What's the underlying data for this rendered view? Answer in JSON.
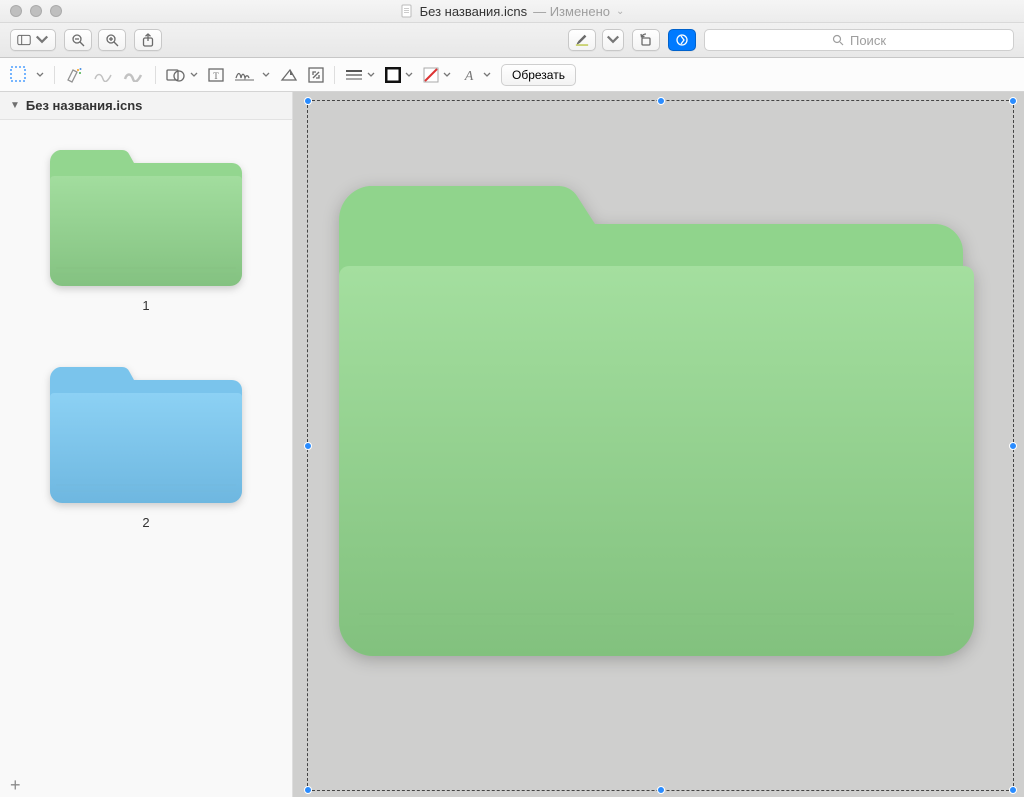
{
  "title": {
    "filename": "Без названия.icns",
    "separator": " — ",
    "status": "Изменено"
  },
  "toolbar": {
    "search_placeholder": "Поиск"
  },
  "markup": {
    "crop_label": "Обрезать"
  },
  "sidebar": {
    "header": "Без названия.icns",
    "thumbnails": [
      {
        "label": "1",
        "color": "green"
      },
      {
        "label": "2",
        "color": "blue"
      }
    ],
    "add_label": "+"
  },
  "canvas": {
    "main_color": "green"
  },
  "colors": {
    "green_tab": "#93d68f",
    "green_body_top": "#a2dd9e",
    "green_body_bot": "#84c281",
    "blue_tab": "#7ac4ec",
    "blue_body_top": "#8cd1f4",
    "blue_body_bot": "#6eb7e0"
  }
}
